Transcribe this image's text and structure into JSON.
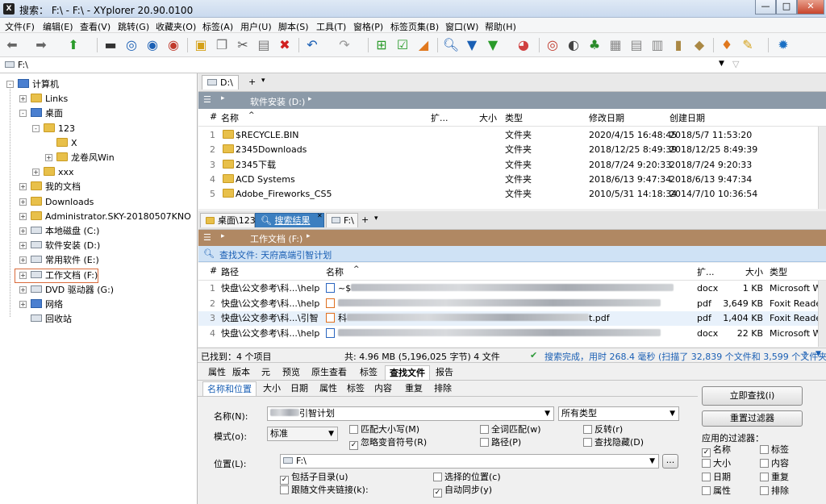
{
  "window": {
    "title": "搜索： F:\\ - F:\\ - XYplorer 20.90.0100",
    "icon": "X",
    "min": "—",
    "max": "□",
    "close": "✕"
  },
  "menu": [
    "文件(F)",
    "编辑(E)",
    "查看(V)",
    "跳转(G)",
    "收藏夹(O)",
    "标签(A)",
    "用户(U)",
    "脚本(S)",
    "工具(T)",
    "窗格(P)",
    "标签页集(B)",
    "窗口(W)",
    "帮助(H)"
  ],
  "toolbar_icons": [
    "back-arrow",
    "forward-arrow",
    "up-arrow",
    "monitor",
    "target-1",
    "search-circle",
    "target-2",
    "new-folder",
    "copy",
    "cut",
    "paste",
    "delete",
    "undo",
    "redo",
    "tree-toggle",
    "checkbox",
    "highlight",
    "find",
    "filter",
    "filter-2",
    "pie",
    "spiral",
    "moon",
    "tree",
    "grid",
    "thumbs",
    "panel",
    "tag",
    "palette",
    "brush",
    "settings"
  ],
  "address": {
    "path": "F:\\"
  },
  "tree": [
    {
      "label": "计算机",
      "icon": "pc",
      "level": 0,
      "exp": "-"
    },
    {
      "label": "Links",
      "icon": "folder",
      "level": 1,
      "exp": "+"
    },
    {
      "label": "桌面",
      "icon": "pc",
      "level": 1,
      "exp": "-"
    },
    {
      "label": "123",
      "icon": "folder",
      "level": 2,
      "exp": "-"
    },
    {
      "label": "X",
      "icon": "folder",
      "level": 3,
      "exp": ""
    },
    {
      "label": "龙卷风Win",
      "icon": "folder",
      "level": 3,
      "exp": "+"
    },
    {
      "label": "xxx",
      "icon": "folder",
      "level": 2,
      "exp": "+"
    },
    {
      "label": "我的文档",
      "icon": "folder",
      "level": 1,
      "exp": "+"
    },
    {
      "label": "Downloads",
      "icon": "folder",
      "level": 1,
      "exp": "+"
    },
    {
      "label": "Administrator.SKY-20180507KNO",
      "icon": "folder",
      "level": 1,
      "exp": "+"
    },
    {
      "label": "本地磁盘 (C:)",
      "icon": "drive",
      "level": 1,
      "exp": "+"
    },
    {
      "label": "软件安装 (D:)",
      "icon": "drive",
      "level": 1,
      "exp": "+"
    },
    {
      "label": "常用软件 (E:)",
      "icon": "drive",
      "level": 1,
      "exp": "+"
    },
    {
      "label": "工作文档 (F:)",
      "icon": "drive",
      "level": 1,
      "exp": "+"
    },
    {
      "label": "DVD 驱动器 (G:)",
      "icon": "drive",
      "level": 1,
      "exp": "+"
    },
    {
      "label": "网络",
      "icon": "pc",
      "level": 1,
      "exp": "+"
    },
    {
      "label": "回收站",
      "icon": "drive",
      "level": 1,
      "exp": ""
    }
  ],
  "pane1": {
    "tab": "D:\\",
    "tab_add": "+",
    "tab_menu": "▾",
    "breadcrumb": "软件安装 (D:)",
    "cols": {
      "num": "#",
      "name": "名称",
      "ext": "扩...",
      "size": "大小",
      "type": "类型",
      "mdate": "修改日期",
      "cdate": "创建日期"
    },
    "rows": [
      {
        "n": "1",
        "name": "$RECYCLE.BIN",
        "type": "文件夹",
        "m": "2020/4/15 16:48:45",
        "c": "2018/5/7 11:53:20"
      },
      {
        "n": "2",
        "name": "2345Downloads",
        "type": "文件夹",
        "m": "2018/12/25 8:49:39",
        "c": "2018/12/25 8:49:39"
      },
      {
        "n": "3",
        "name": "2345下载",
        "type": "文件夹",
        "m": "2018/7/24 9:20:33",
        "c": "2018/7/24 9:20:33"
      },
      {
        "n": "4",
        "name": "ACD Systems",
        "type": "文件夹",
        "m": "2018/6/13 9:47:34",
        "c": "2018/6/13 9:47:34"
      },
      {
        "n": "5",
        "name": "Adobe_Fireworks_CS5",
        "type": "文件夹",
        "m": "2010/5/31 14:18:34",
        "c": "2014/7/10 10:36:54"
      }
    ]
  },
  "pane2": {
    "tabs": [
      "桌面\\123",
      "搜索结果",
      "F:\\"
    ],
    "breadcrumb": "工作文档 (F:)",
    "find_bar": "查找文件: 天府高端引智计划",
    "cols": {
      "num": "#",
      "path": "路径",
      "name": "名称",
      "ext": "扩...",
      "size": "大小",
      "type": "类型"
    },
    "rows": [
      {
        "n": "1",
        "path": "快盘\\公文参考\\科...\\help",
        "name": "~$",
        "ext": "docx",
        "size": "1 KB",
        "type": "Microsoft W"
      },
      {
        "n": "2",
        "path": "快盘\\公文参考\\科...\\help",
        "name": "",
        "ext": "pdf",
        "size": "3,649 KB",
        "type": "Foxit Reader"
      },
      {
        "n": "3",
        "path": "快盘\\公文参考\\科...\\引智",
        "name": "科",
        "ext": "pdf",
        "size": "1,404 KB",
        "type": "Foxit Reader"
      },
      {
        "n": "4",
        "path": "快盘\\公文参考\\科...\\help",
        "name": "",
        "ext": "docx",
        "size": "22 KB",
        "type": "Microsoft W"
      }
    ],
    "row3_suffix": "t.pdf"
  },
  "status": {
    "found": "已找到：4 个项目",
    "total": "共: 4.96 MB (5,196,025 字节)  4 文件",
    "done": "搜索完成，用时 268.4 毫秒 (扫描了 32,839 个文件和 3,599 个文件夹)"
  },
  "info_tabs": [
    "属性",
    "版本",
    "元",
    "预览",
    "原生查看",
    "标签",
    "查找文件",
    "报告"
  ],
  "find_tabs": [
    "名称和位置",
    "大小",
    "日期",
    "属性",
    "标签",
    "内容",
    "重复",
    "排除"
  ],
  "find": {
    "name_label": "名称(N):",
    "name_value": "引智计划",
    "type_value": "所有类型",
    "mode_label": "模式(o):",
    "mode_value": "标准",
    "match_case": "匹配大小写(M)",
    "ignore_diacritics": "忽略变音符号(R)",
    "whole_words": "全词匹配(w)",
    "path": "路径(P)",
    "invert": "反转(r)",
    "find_hidden": "查找隐藏(D)",
    "loc_label": "位置(L):",
    "loc_value": "F:\\",
    "browse": "...",
    "include_sub": "包括子目录(u)",
    "follow_links": "跟随文件夹链接(k):",
    "selected_loc": "选择的位置(c)",
    "auto_sync": "自动同步(y)",
    "find_now": "立即查找(i)",
    "reset": "重置过滤器",
    "applied_label": "应用的过滤器：",
    "filters": [
      {
        "l": "名称",
        "c": true
      },
      {
        "l": "标签",
        "c": false
      },
      {
        "l": "大小",
        "c": false
      },
      {
        "l": "内容",
        "c": false
      },
      {
        "l": "日期",
        "c": false
      },
      {
        "l": "重复",
        "c": false
      },
      {
        "l": "属性",
        "c": false
      },
      {
        "l": "排除",
        "c": false
      }
    ]
  },
  "colors": {
    "accent": "#3c7fc0",
    "breadcrumb_gray": "#8c9aa8",
    "breadcrumb_orange": "#b08863",
    "status_green": "#2e9a3a"
  }
}
